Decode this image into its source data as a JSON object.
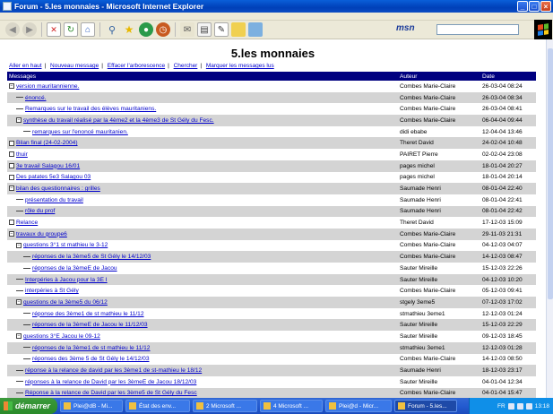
{
  "window": {
    "title": "Forum - 5.les monnaies - Microsoft Internet Explorer",
    "buttons": {
      "minimize": "_",
      "maximize": "□",
      "close": "×"
    }
  },
  "toolbar": {
    "icons": [
      "back-icon",
      "forward-icon",
      "stop-icon",
      "refresh-icon",
      "home-icon",
      "search-icon",
      "favorites-icon",
      "media-icon",
      "history-icon",
      "mail-icon",
      "print-icon",
      "edit-icon",
      "folder-icon",
      "messenger-icon"
    ],
    "msn_label": "msn"
  },
  "page": {
    "title": "5.les monnaies",
    "nav": [
      "Aller en haut",
      "Nouveau message",
      "Effacer l'arborescence",
      "Chercher",
      "Marquer les messages lus"
    ],
    "headers": {
      "messages": "Messages",
      "author": "Auteur",
      "date": "Date"
    },
    "rows": [
      {
        "indent": 0,
        "node": "box-minus",
        "title": "version mauritannienne.",
        "author": "Combes Marie-Claire",
        "date": "26-03-04 08:24"
      },
      {
        "indent": 1,
        "node": "dash",
        "title": "énoncé.",
        "author": "Combes Marie-Claire",
        "date": "26-03-04 08:34"
      },
      {
        "indent": 1,
        "node": "dash",
        "title": "Remarques sur le travail des élèves mauritaniens.",
        "author": "Combes Marie-Claire",
        "date": "26-03-04 08:41"
      },
      {
        "indent": 1,
        "node": "box-minus",
        "title": "synthèse du travail réalisé par la 4ème2 et la 4ème3 de St Gély du Fesc.",
        "author": "Combes Marie-Claire",
        "date": "06-04-04 09:44"
      },
      {
        "indent": 2,
        "node": "dash",
        "title": "remarques sur l'enoncé mauritanien.",
        "author": "didi ebabe",
        "date": "12-04-04 13:46"
      },
      {
        "indent": 0,
        "node": "box",
        "title": "Bilan final (24-02-2004)",
        "author": "Theret David",
        "date": "24-02-04 10:48"
      },
      {
        "indent": 0,
        "node": "box",
        "title": "thuir",
        "author": "PAIRET Pierre",
        "date": "02-02-04 23:08"
      },
      {
        "indent": 0,
        "node": "box",
        "title": "3e travail Salagou 16/01",
        "author": "pages michel",
        "date": "18-01-04 20:27"
      },
      {
        "indent": 0,
        "node": "box",
        "title": "Des patates 5e3 Salagou 03",
        "author": "pages michel",
        "date": "18-01-04 20:14"
      },
      {
        "indent": 0,
        "node": "box-minus",
        "title": "bilan des questionnaires : grilles",
        "author": "Saumade Henri",
        "date": "08-01-04 22:40"
      },
      {
        "indent": 1,
        "node": "dash",
        "title": "présentation du travail",
        "author": "Saumade Henri",
        "date": "08-01-04 22:41"
      },
      {
        "indent": 1,
        "node": "dash",
        "title": "rôle du prof",
        "author": "Saumade Henri",
        "date": "08-01-04 22:42"
      },
      {
        "indent": 0,
        "node": "box",
        "title": "Relance",
        "author": "Theret David",
        "date": "17-12-03 15:09"
      },
      {
        "indent": 0,
        "node": "box-minus",
        "title": "travaux du groupe6",
        "author": "Combes Marie-Claire",
        "date": "29-11-03 21:31"
      },
      {
        "indent": 1,
        "node": "box-minus",
        "title": "questions 3°1 st mathieu le 3-12",
        "author": "Combes Marie-Claire",
        "date": "04-12-03 04:07"
      },
      {
        "indent": 2,
        "node": "dash",
        "title": "réponses de la 3ème5 de St Gély le 14/12/03",
        "author": "Combes Marie-Claire",
        "date": "14-12-03 08:47"
      },
      {
        "indent": 2,
        "node": "dash",
        "title": "réponses de la 3èmeE de Jacou",
        "author": "Sauter Mireille",
        "date": "15-12-03 22:26"
      },
      {
        "indent": 1,
        "node": "dash",
        "title": "Interpéries à Jacou pour la 3E I",
        "author": "Sauter Mireille",
        "date": "04-12-03 10:20"
      },
      {
        "indent": 1,
        "node": "dash",
        "title": "interpéries à St Gély",
        "author": "Combes Marie-Claire",
        "date": "05-12-03 09:41"
      },
      {
        "indent": 1,
        "node": "box-minus",
        "title": "questions de la 3ème5 du 06/12",
        "author": "stgely 3eme5",
        "date": "07-12-03 17:02"
      },
      {
        "indent": 2,
        "node": "dash",
        "title": "réponse des 3ème1 de st mathieu le 11/12",
        "author": "stmathieu 3eme1",
        "date": "12-12-03 01:24"
      },
      {
        "indent": 2,
        "node": "dash",
        "title": "réponses de la 3èmeE de Jacou le 11/12/03",
        "author": "Sauter Mireille",
        "date": "15-12-03 22:29"
      },
      {
        "indent": 1,
        "node": "box-minus",
        "title": "questions 3°E Jacou le 09-12",
        "author": "Sauter Mireille",
        "date": "09-12-03 18:45"
      },
      {
        "indent": 2,
        "node": "dash",
        "title": "réponses de la 3ème1 de st mathieu le 11/12",
        "author": "stmathieu 3eme1",
        "date": "12-12-03 01:28"
      },
      {
        "indent": 2,
        "node": "dash",
        "title": "réponses des 3ème 5 de St Gély le 14/12/03",
        "author": "Combes Marie-Claire",
        "date": "14-12-03 08:50"
      },
      {
        "indent": 1,
        "node": "dash",
        "title": "réponse à la relance de david par les 3ème1 de st-mathieu le 18/12",
        "author": "Saumade Henri",
        "date": "18-12-03 23:17"
      },
      {
        "indent": 1,
        "node": "dash",
        "title": "réponses à la relance de David par les 3èmeE de Jacou 18/12/03",
        "author": "Sauter Mireille",
        "date": "04-01-04 12:34"
      },
      {
        "indent": 1,
        "node": "dash",
        "title": "Réponse à la relance de David par les 3ème5 de St Gély du Fesc",
        "author": "Combes Marie-Claire",
        "date": "04-01-04 15:47"
      }
    ]
  },
  "taskbar": {
    "start": "démarrer",
    "tasks": [
      {
        "label": "Plei@dB - Mi...",
        "active": false
      },
      {
        "label": "État des env...",
        "active": false
      },
      {
        "label": "2 Microsoft ...",
        "active": false
      },
      {
        "label": "4 Microsoft ...",
        "active": false
      },
      {
        "label": "Plei@d - Micr...",
        "active": false
      },
      {
        "label": "Forum - 5.les...",
        "active": true
      }
    ],
    "lang": "FR",
    "clock": "13:18"
  }
}
